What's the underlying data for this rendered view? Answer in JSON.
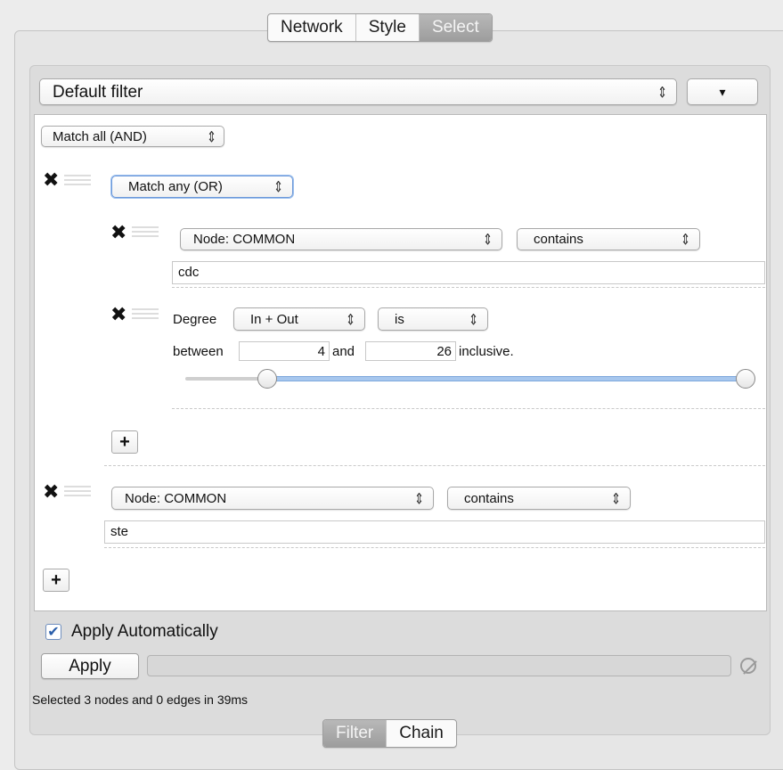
{
  "top_tabs": [
    "Network",
    "Style",
    "Select"
  ],
  "filter_select": {
    "value": "Default filter",
    "menu_glyph": "▾"
  },
  "root_match": "Match all (AND)",
  "group": {
    "match": "Match any (OR)",
    "text_filter": {
      "column": "Node: COMMON",
      "operator": "contains",
      "value": "cdc"
    },
    "degree_filter": {
      "label": "Degree",
      "direction": "In + Out",
      "predicate": "is",
      "between_label": "between",
      "and_label": "and",
      "inclusive_label": "inclusive.",
      "min": "4",
      "max": "26",
      "slider_low_fraction": 0.15,
      "slider_high_fraction": 1.0
    }
  },
  "text_filter_2": {
    "column": "Node: COMMON",
    "operator": "contains",
    "value": "ste"
  },
  "apply_auto": {
    "label": "Apply Automatically",
    "checked": true
  },
  "apply_button": "Apply",
  "status": "Selected 3 nodes and 0 edges in 39ms",
  "bottom_tabs": [
    "Filter",
    "Chain"
  ],
  "glyphs": {
    "remove": "✖",
    "add": "+",
    "updown": "⌃⌄",
    "check": "✔"
  }
}
